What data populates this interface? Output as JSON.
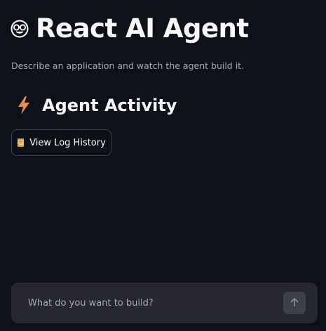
{
  "header": {
    "icon": "nerd-face-emoji-icon",
    "title": "React AI Agent",
    "subtitle": "Describe an application and watch the agent build it."
  },
  "activity": {
    "icon": "lightning-bolt-icon",
    "title": "Agent Activity",
    "log_button": {
      "icon": "scroll-icon",
      "label": "View Log History"
    }
  },
  "chat": {
    "placeholder": "What do you want to build?",
    "value": "",
    "send_icon": "arrow-up-icon"
  },
  "colors": {
    "background": "#0e1117",
    "chat_bar": "#262730",
    "bolt": "#f08a4b",
    "muted_text": "#a3a8b4"
  }
}
